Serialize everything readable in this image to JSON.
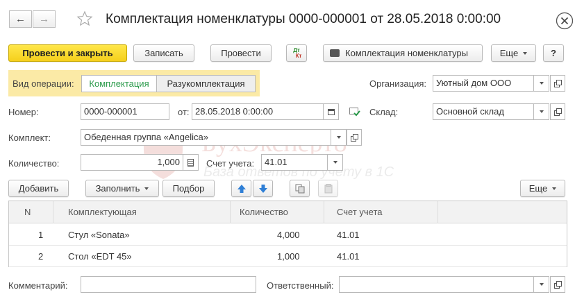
{
  "window": {
    "title": "Комплектация номенклатуры 0000-000001 от 28.05.2018 0:00:00"
  },
  "toolbar": {
    "post_close_label": "Провести и закрыть",
    "save_label": "Записать",
    "post_label": "Провести",
    "dtkt_top": "Дт",
    "dtkt_bottom": "Кт",
    "print_label": "Комплектация номенклатуры",
    "more_label": "Еще",
    "help_label": "?"
  },
  "operation": {
    "label": "Вид операции:",
    "options": [
      "Комплектация",
      "Разукомплектация"
    ],
    "selected": "Комплектация"
  },
  "organization": {
    "label": "Организация:",
    "value": "Уютный дом ООО"
  },
  "number": {
    "label": "Номер:",
    "value": "0000-000001"
  },
  "date": {
    "label": "от:",
    "value": "28.05.2018  0:00:00"
  },
  "warehouse": {
    "label": "Склад:",
    "value": "Основной склад"
  },
  "kit": {
    "label": "Комплект:",
    "value": "Обеденная группа «Angelica»"
  },
  "quantity": {
    "label": "Количество:",
    "value": "1,000"
  },
  "account": {
    "label": "Счет учета:",
    "value": "41.01"
  },
  "table_toolbar": {
    "add_label": "Добавить",
    "fill_label": "Заполнить",
    "pick_label": "Подбор",
    "more_label": "Еще"
  },
  "table": {
    "headers": [
      "N",
      "Комплектующая",
      "Количество",
      "Счет учета"
    ],
    "rows": [
      {
        "n": "1",
        "item": "Стул «Sonata»",
        "qty": "4,000",
        "account": "41.01"
      },
      {
        "n": "2",
        "item": "Стол «EDT 45»",
        "qty": "1,000",
        "account": "41.01"
      }
    ]
  },
  "comment": {
    "label": "Комментарий:",
    "value": ""
  },
  "responsible": {
    "label": "Ответственный:",
    "value": ""
  },
  "watermark": {
    "brand": "БухЭксперт8",
    "tagline": "База ответов по учёту в 1С"
  },
  "colors": {
    "accent_yellow": "#f5cf1c",
    "highlight": "#fbeaa6",
    "selected_green": "#2a9a4a",
    "blue_arrow": "#2f7fd6"
  }
}
